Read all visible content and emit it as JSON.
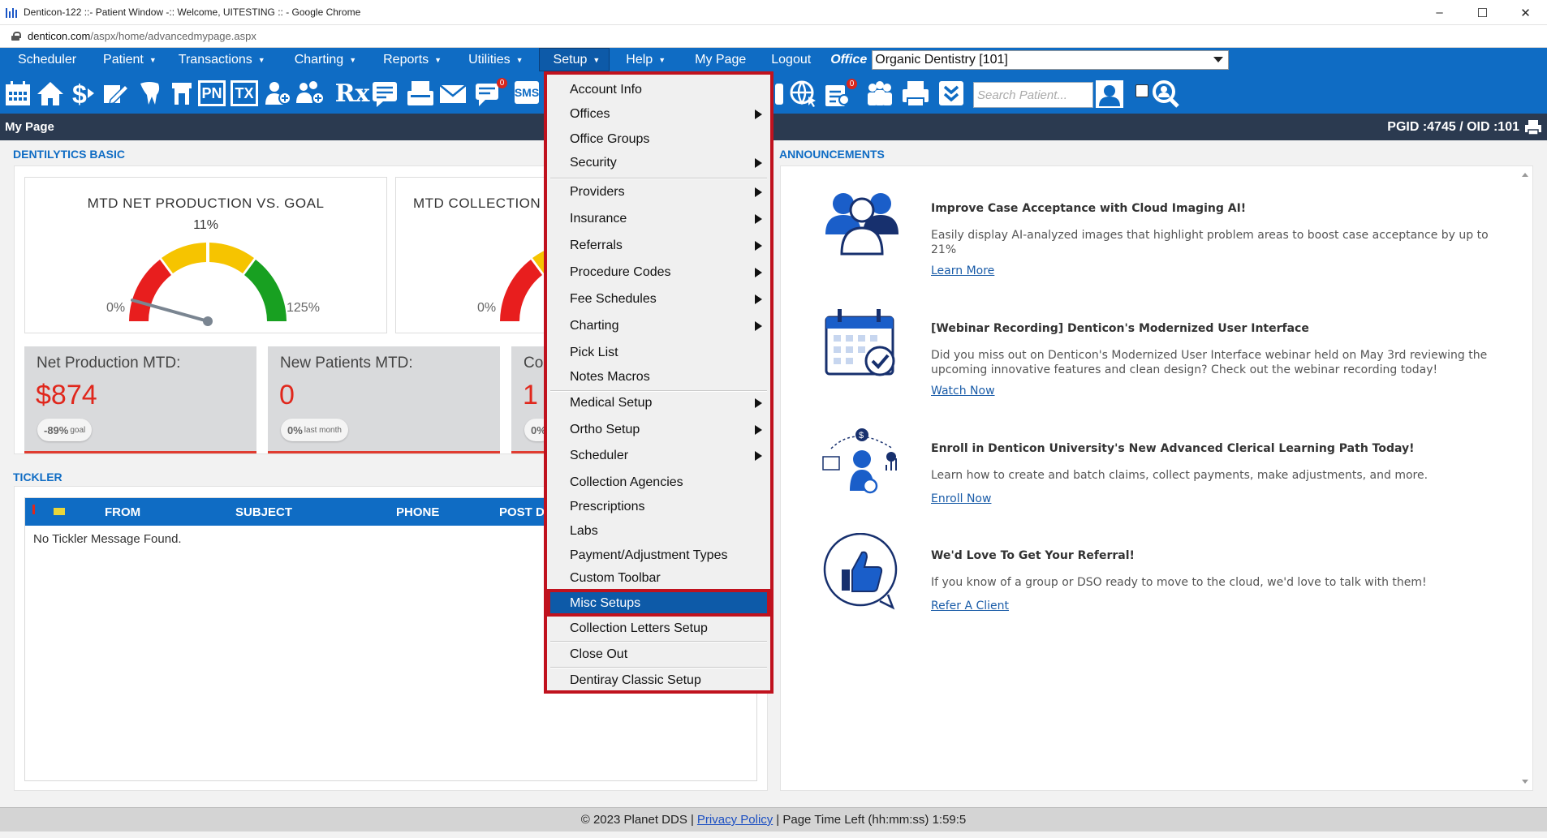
{
  "browser": {
    "title": "Denticon-122 ::- Patient Window -:: Welcome, UITESTING :: - Google Chrome",
    "url_domain": "denticon.com",
    "url_path": "/aspx/home/advancedmypage.aspx",
    "controls": [
      "–",
      "☐",
      "✕"
    ]
  },
  "menu": {
    "items": [
      {
        "label": "Scheduler",
        "caret": false
      },
      {
        "label": "Patient",
        "caret": true
      },
      {
        "label": "Transactions",
        "caret": true
      },
      {
        "label": "Charting",
        "caret": true
      },
      {
        "label": "Reports",
        "caret": true
      },
      {
        "label": "Utilities",
        "caret": true
      },
      {
        "label": "Setup",
        "caret": true
      },
      {
        "label": "Help",
        "caret": true
      },
      {
        "label": "My Page",
        "caret": false
      },
      {
        "label": "Logout",
        "caret": false
      }
    ],
    "caret_glyph": "▼",
    "office_label": "Office",
    "office_value": "Organic Dentistry [101]"
  },
  "toolbar": {
    "search_placeholder": "Search Patient...",
    "badge_messages": "0",
    "badge_alerts": "0",
    "text_icons": {
      "pn": "PN",
      "tx": "TX",
      "rx": "Rx",
      "sms": "SMS"
    }
  },
  "pagebar": {
    "title": "My Page",
    "pgid": "PGID :4745  /  OID :101"
  },
  "dentilytics": {
    "section_title": "DENTILYTICS BASIC",
    "gauges": [
      {
        "title": "MTD NET PRODUCTION VS. GOAL",
        "pct": "11%",
        "low": "0%",
        "high": "125%",
        "value_fraction": 0.11
      },
      {
        "title": "MTD COLLECTION",
        "pct": "",
        "low": "0%",
        "high": "",
        "value_fraction": 0
      }
    ],
    "stats": [
      {
        "label": "Net Production MTD:",
        "value": "$874",
        "chip_bold": "-89%",
        "chip_small": "goal"
      },
      {
        "label": "New Patients MTD:",
        "value": "0",
        "chip_bold": "0%",
        "chip_small": "last month"
      },
      {
        "label": "Co",
        "value": "1",
        "chip_bold": "0%",
        "chip_small": ""
      }
    ]
  },
  "tickler": {
    "section_title": "TICKLER",
    "columns": [
      "FROM",
      "SUBJECT",
      "PHONE",
      "POST D."
    ],
    "empty_text": "No Tickler Message Found."
  },
  "announcements": {
    "section_title": "ANNOUNCEMENTS",
    "items": [
      {
        "icon": "people-icon",
        "title": "Improve Case Acceptance with Cloud Imaging AI!",
        "body": "Easily display AI-analyzed images that highlight problem areas to boost case acceptance by up to 21%",
        "link": "Learn More"
      },
      {
        "icon": "calendar-check-icon",
        "title": "[Webinar Recording] Denticon's Modernized User Interface",
        "body": "Did you miss out on Denticon's Modernized User Interface webinar held on May 3rd reviewing the upcoming innovative features and clean design? Check out the webinar recording today!",
        "link": "Watch Now"
      },
      {
        "icon": "learning-path-icon",
        "title": "Enroll in Denticon University's New Advanced Clerical Learning Path Today!",
        "body": "Learn how to create and batch claims, collect payments, make adjustments, and more.",
        "link": "Enroll Now"
      },
      {
        "icon": "thumbs-up-icon",
        "title": "We'd Love To Get Your Referral!",
        "body": "If you know of a group or DSO ready to move to the cloud, we'd love to talk with them!",
        "link": "Refer A Client"
      }
    ]
  },
  "setup_menu": {
    "items": [
      {
        "label": "Account Info",
        "submenu": false
      },
      {
        "label": "Offices",
        "submenu": true
      },
      {
        "label": "Office Groups",
        "submenu": false
      },
      {
        "label": "Security",
        "submenu": true
      },
      {
        "label": "Providers",
        "submenu": true
      },
      {
        "label": "Insurance",
        "submenu": true
      },
      {
        "label": "Referrals",
        "submenu": true
      },
      {
        "label": "Procedure Codes",
        "submenu": true
      },
      {
        "label": "Fee Schedules",
        "submenu": true
      },
      {
        "label": "Charting",
        "submenu": true
      },
      {
        "label": "Pick List",
        "submenu": false
      },
      {
        "label": "Notes Macros",
        "submenu": false
      },
      {
        "label": "Medical Setup",
        "submenu": true
      },
      {
        "label": "Ortho Setup",
        "submenu": true
      },
      {
        "label": "Scheduler",
        "submenu": true
      },
      {
        "label": "Collection Agencies",
        "submenu": false
      },
      {
        "label": "Prescriptions",
        "submenu": false
      },
      {
        "label": "Labs",
        "submenu": false
      },
      {
        "label": "Payment/Adjustment Types",
        "submenu": false
      },
      {
        "label": "Custom Toolbar",
        "submenu": false
      },
      {
        "label": "Misc Setups",
        "submenu": false,
        "highlighted": true
      },
      {
        "label": "Collection Letters Setup",
        "submenu": false
      },
      {
        "label": "Close Out",
        "submenu": false
      },
      {
        "label": "Dentiray Classic Setup",
        "submenu": false
      }
    ]
  },
  "footer": {
    "copyright": "© 2023 Planet DDS |",
    "privacy": "Privacy Policy",
    "time_left": "|  Page Time Left (hh:mm:ss) 1:59:5"
  },
  "colors": {
    "brand_blue": "#0f6cc4",
    "dark_bar": "#2b3a50",
    "highlight_red": "#c0121e",
    "stat_red": "#e0271c"
  }
}
